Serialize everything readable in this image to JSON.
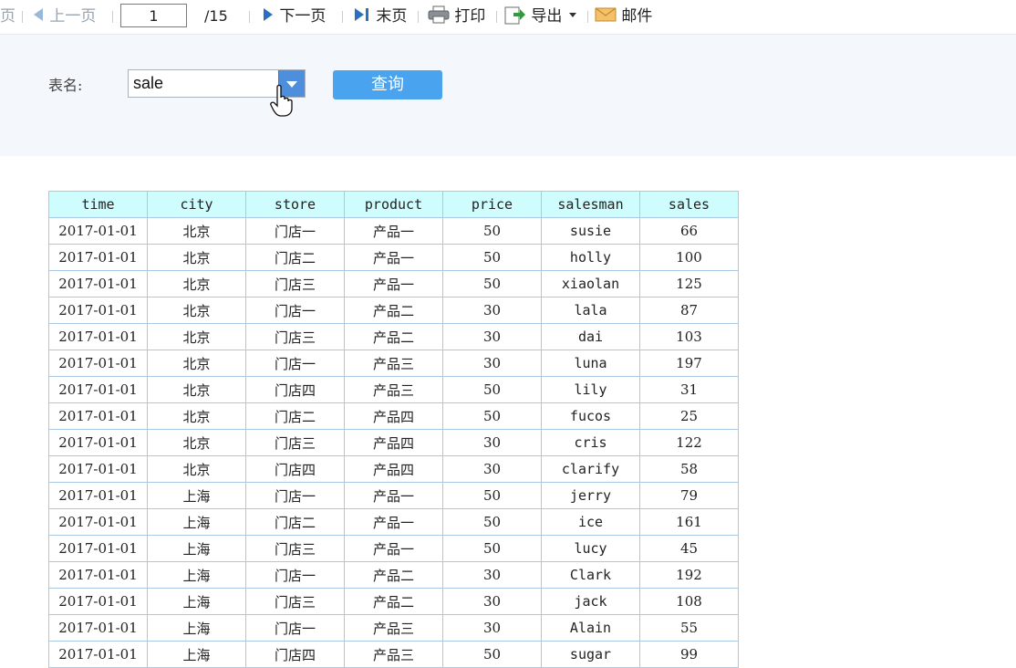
{
  "toolbar": {
    "first_page_partial": "页",
    "prev_page": "上一页",
    "current_page": "1",
    "total_pages": "/15",
    "next_page": "下一页",
    "last_page": "末页",
    "print": "打印",
    "export": "导出",
    "email": "邮件"
  },
  "query": {
    "table_label": "表名:",
    "table_value": "sale",
    "query_button": "查询"
  },
  "table": {
    "headers": [
      "time",
      "city",
      "store",
      "product",
      "price",
      "salesman",
      "sales"
    ],
    "rows": [
      [
        "2017-01-01",
        "北京",
        "门店一",
        "产品一",
        "50",
        "susie",
        "66"
      ],
      [
        "2017-01-01",
        "北京",
        "门店二",
        "产品一",
        "50",
        "holly",
        "100"
      ],
      [
        "2017-01-01",
        "北京",
        "门店三",
        "产品一",
        "50",
        "xiaolan",
        "125"
      ],
      [
        "2017-01-01",
        "北京",
        "门店一",
        "产品二",
        "30",
        "lala",
        "87"
      ],
      [
        "2017-01-01",
        "北京",
        "门店三",
        "产品二",
        "30",
        "dai",
        "103"
      ],
      [
        "2017-01-01",
        "北京",
        "门店一",
        "产品三",
        "30",
        "luna",
        "197"
      ],
      [
        "2017-01-01",
        "北京",
        "门店四",
        "产品三",
        "50",
        "lily",
        "31"
      ],
      [
        "2017-01-01",
        "北京",
        "门店二",
        "产品四",
        "50",
        "fucos",
        "25"
      ],
      [
        "2017-01-01",
        "北京",
        "门店三",
        "产品四",
        "30",
        "cris",
        "122"
      ],
      [
        "2017-01-01",
        "北京",
        "门店四",
        "产品四",
        "30",
        "clarify",
        "58"
      ],
      [
        "2017-01-01",
        "上海",
        "门店一",
        "产品一",
        "50",
        "jerry",
        "79"
      ],
      [
        "2017-01-01",
        "上海",
        "门店二",
        "产品一",
        "50",
        "ice",
        "161"
      ],
      [
        "2017-01-01",
        "上海",
        "门店三",
        "产品一",
        "50",
        "lucy",
        "45"
      ],
      [
        "2017-01-01",
        "上海",
        "门店一",
        "产品二",
        "30",
        "Clark",
        "192"
      ],
      [
        "2017-01-01",
        "上海",
        "门店三",
        "产品二",
        "30",
        "jack",
        "108"
      ],
      [
        "2017-01-01",
        "上海",
        "门店一",
        "产品三",
        "30",
        "Alain",
        "55"
      ],
      [
        "2017-01-01",
        "上海",
        "门店四",
        "产品三",
        "50",
        "sugar",
        "99"
      ]
    ]
  },
  "colors": {
    "header_bg": "#cffcfd",
    "grid_border": "#a9c9e4",
    "button_bg": "#4aa3ee",
    "panel_bg": "#f4f8fd"
  }
}
